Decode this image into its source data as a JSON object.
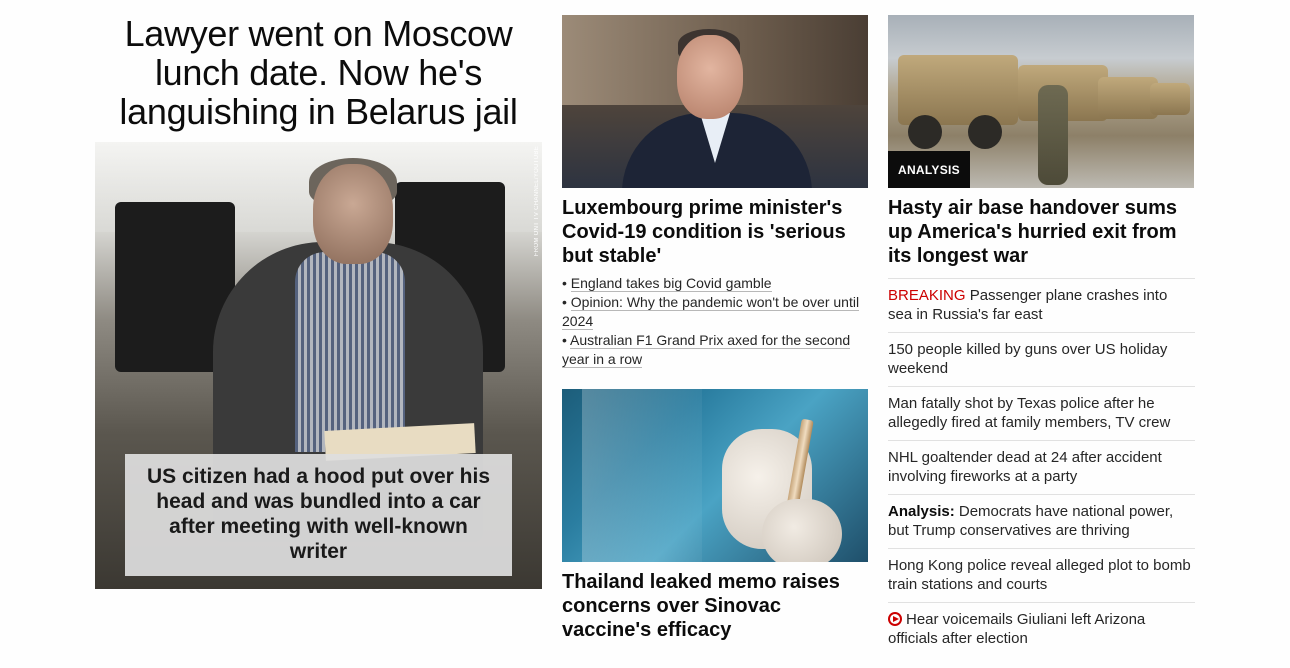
{
  "lead": {
    "headline": "Lawyer went on Moscow lunch date. Now he's languishing in Belarus jail",
    "caption": "US citizen had a hood put over his head and was bundled into a car after meeting with well-known writer",
    "image_credit": "FROM ONT TV CHANNEL/YOUTUBE"
  },
  "col2": {
    "story1": {
      "headline": "Luxembourg prime minister's Covid-19 condition is 'serious but stable'",
      "related": [
        "England takes big Covid gamble",
        "Opinion: Why the pandemic won't be over until 2024",
        "Australian F1 Grand Prix axed for the second year in a row"
      ]
    },
    "story2": {
      "headline": "Thailand leaked memo raises concerns over Sinovac vaccine's efficacy"
    }
  },
  "col3": {
    "badge": "ANALYSIS",
    "headline": "Hasty air base handover sums up America's hurried exit from its longest war",
    "list": [
      {
        "prefix": "BREAKING",
        "text": " Passenger plane crashes into sea in Russia's far east"
      },
      {
        "text": "150 people killed by guns over US holiday weekend"
      },
      {
        "text": "Man fatally shot by Texas police after he allegedly fired at family members, TV crew"
      },
      {
        "text": "NHL goaltender dead at 24 after accident involving fireworks at a party"
      },
      {
        "bold": "Analysis:",
        "text": " Democrats have national power, but Trump conservatives are thriving"
      },
      {
        "text": "Hong Kong police reveal alleged plot to bomb train stations and courts"
      },
      {
        "icon": "play-icon",
        "text": "Hear voicemails Giuliani left Arizona officials after election"
      }
    ]
  },
  "colors": {
    "breaking": "#cc0000",
    "text": "#0c0c0c",
    "divider": "#e1e1e1"
  }
}
